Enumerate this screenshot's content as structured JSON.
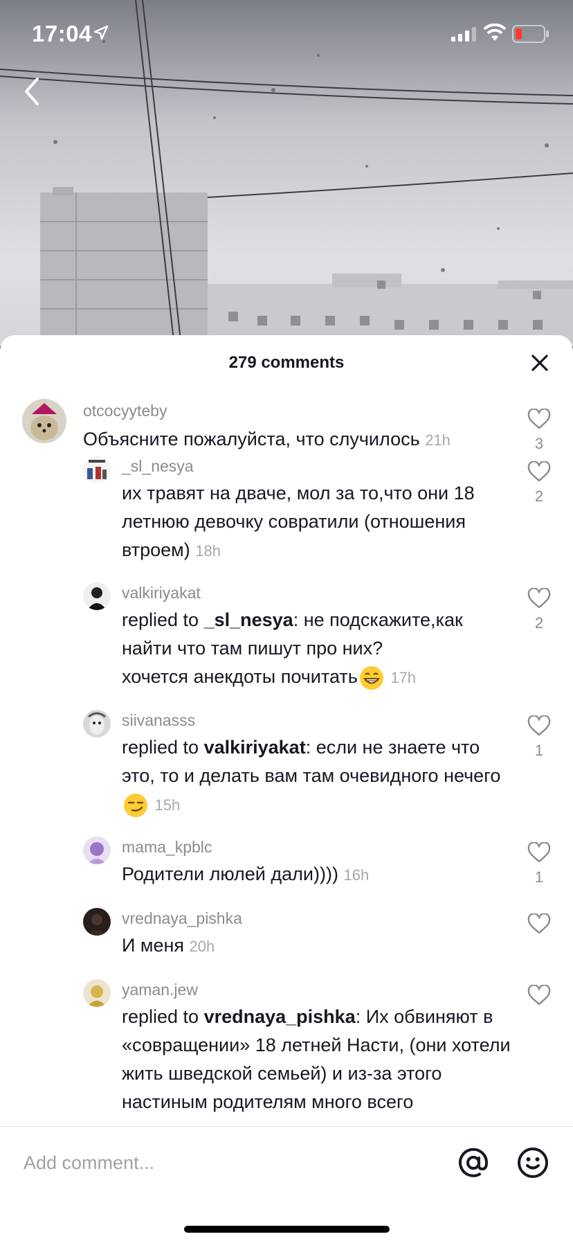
{
  "status_bar": {
    "time": "17:04"
  },
  "sheet": {
    "title": "279 comments"
  },
  "comments": [
    {
      "username": "otcocyyteby",
      "text": "Объясните пожалуйста, что случилось",
      "time": "21h",
      "likes": "3"
    },
    {
      "username": "_sl_nesya",
      "text": "их травят на дваче, мол за то,что они 18 летнюю девочку совратили (отношения втроем)",
      "time": "18h",
      "likes": "2"
    },
    {
      "username": "valkiriyakat",
      "replied_prefix": "replied to ",
      "reply_to": "_sl_nesya",
      "text_line1": ": не подскажите,как найти что там пишут про них?",
      "text_line2": "хочется анекдоты почитать",
      "time": "17h",
      "likes": "2"
    },
    {
      "username": "siivanasss",
      "replied_prefix": "replied to ",
      "reply_to": "valkiriyakat",
      "text": ": если не знаете что это, то и делать вам там очевидного нечего",
      "time": "15h",
      "likes": "1"
    },
    {
      "username": "mama_kpblc",
      "text": "Родители люлей дали))))",
      "time": "16h",
      "likes": "1"
    },
    {
      "username": "vrednaya_pishka",
      "text": "И меня",
      "time": "20h",
      "likes": ""
    },
    {
      "username": "yaman.jew",
      "replied_prefix": "replied to ",
      "reply_to": "vrednaya_pishka",
      "text": ": Их обвиняют в «совращении» 18 летней Насти, (они хотели жить шведской семьей) и из-за этого настиным родителям много всего",
      "likes": ""
    }
  ],
  "input": {
    "placeholder": "Add comment..."
  },
  "icons": {
    "back": "chevron-left-icon",
    "close": "close-icon",
    "like": "heart-outline-icon",
    "mention": "at-sign-icon",
    "emoji": "smiley-icon",
    "location": "location-arrow-icon",
    "signal": "cellular-signal-icon",
    "wifi": "wifi-icon",
    "battery": "battery-low-icon"
  },
  "colors": {
    "text": "#161823",
    "secondary": "#8a8b91",
    "battery_low": "#ff3b30"
  }
}
